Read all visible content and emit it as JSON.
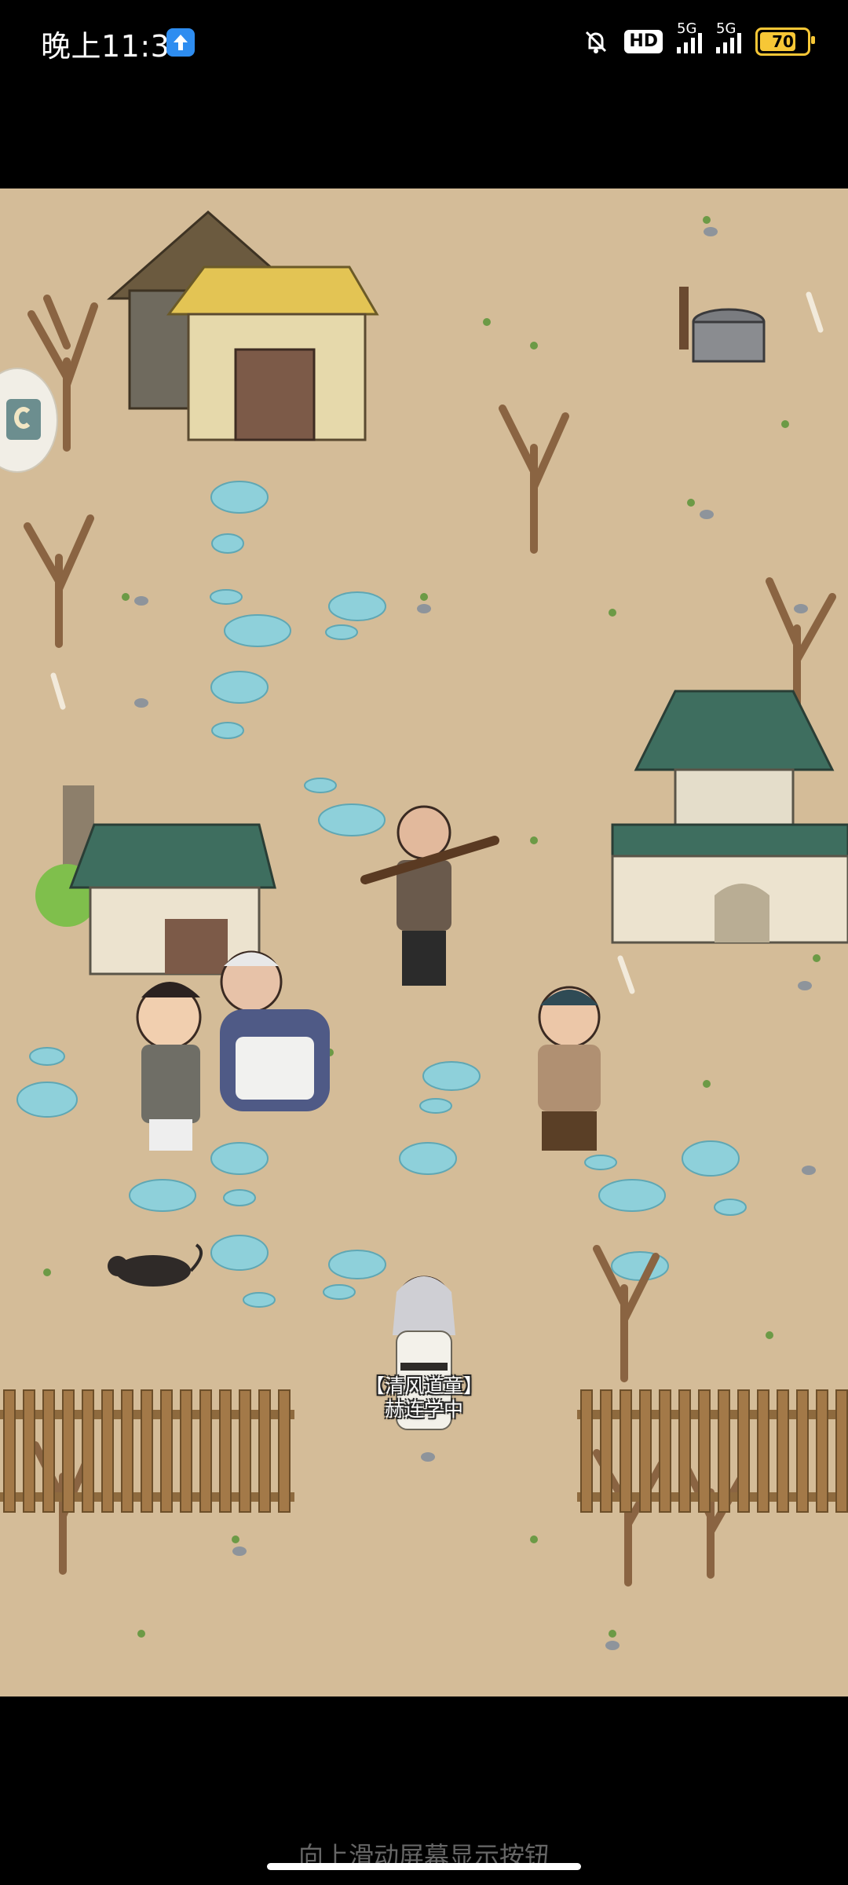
{
  "status_bar": {
    "time": "晚上11:31",
    "hd_badge": "HD",
    "signal_1": "5G",
    "signal_2": "5G",
    "battery": "70"
  },
  "game": {
    "npc_name_line1": "【清风道童】",
    "npc_name_line2": "赫连学中",
    "side_button_icon": "game-menu-icon"
  },
  "nav": {
    "hint": "向上滑动屏幕显示按钮"
  },
  "colors": {
    "ground": "#d4bc98",
    "stone": "#8ed0da",
    "roof_green": "#3e6e5f",
    "thatch": "#e3c454",
    "tree": "#8a6442",
    "fence": "#a37948"
  }
}
